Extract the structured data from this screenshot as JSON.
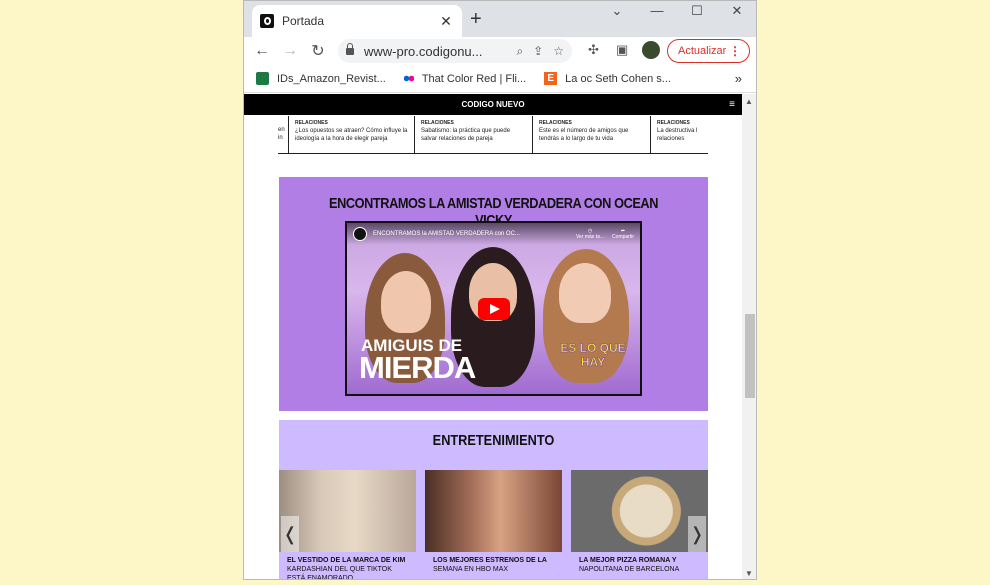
{
  "browser": {
    "tab_title": "Portada",
    "tab_close": "✕",
    "new_tab": "+",
    "window_controls": {
      "dropdown": "⌄",
      "minimize": "—",
      "maximize": "☐",
      "close": "✕"
    },
    "url": "www-pro.codigonu...",
    "update_label": "Actualizar",
    "menu_glyph": "⋮",
    "bookmarks": [
      {
        "label": "IDs_Amazon_Revist...",
        "icon": "excel-icon",
        "color": "#1d7a45"
      },
      {
        "label": "That Color Red | Fli...",
        "icon": "flickr-icon",
        "color": "#ff0084"
      },
      {
        "label": "La oc Seth Cohen s...",
        "icon": "etsy-icon",
        "color": "#f1641e"
      }
    ],
    "bookmarks_more": "»"
  },
  "site": {
    "header_title": "CODIGO NUEVO",
    "menu_glyph": "≡",
    "related": [
      {
        "kicker": "",
        "text": "en\nin"
      },
      {
        "kicker": "RELACIONES",
        "text": "¿Los opuestos se atraen? Cómo influye la ideología a la hora de elegir pareja"
      },
      {
        "kicker": "RELACIONES",
        "text": "Sabatismo: la práctica que puede salvar relaciones de pareja"
      },
      {
        "kicker": "RELACIONES",
        "text": "Este es el número de amigos que tendrás a lo largo de tu vida"
      },
      {
        "kicker": "RELACIONES",
        "text": "La destructiva l relaciones"
      }
    ],
    "video_section": {
      "heading": "ENCONTRAMOS LA AMISTAD VERDADERA CON OCEAN VICKY",
      "video_title": "ENCONTRAMOS la AMISTAD VERDADERA con OC...",
      "watch_later": "Ver más ta...",
      "share": "Compartir",
      "overlay_line1": "AMIGUIS DE",
      "overlay_line2": "MIERDA",
      "badge": "ES LO QUE HAY"
    },
    "entertainment": {
      "heading": "ENTRETENIMIENTO",
      "prev": "❬",
      "next": "❭",
      "cards": [
        {
          "title": "EL VESTIDO DE LA MARCA DE KIM",
          "subtitle": "KARDASHIAN DEL QUE TIKTOK ESTÁ ENAMORADO",
          "image": "kim-kardashian-photo"
        },
        {
          "title": "LOS MEJORES ESTRENOS DE LA",
          "subtitle": "SEMANA EN HBO MAX",
          "image": "couple-photo"
        },
        {
          "title": "LA MEJOR PIZZA ROMANA Y",
          "subtitle": "NAPOLITANA DE BARCELONA",
          "image": "pizza-photo"
        }
      ]
    }
  },
  "colors": {
    "video_section_bg": "#b17ee6",
    "entertainment_bg": "#cdbaff",
    "update_red": "#d93025"
  }
}
